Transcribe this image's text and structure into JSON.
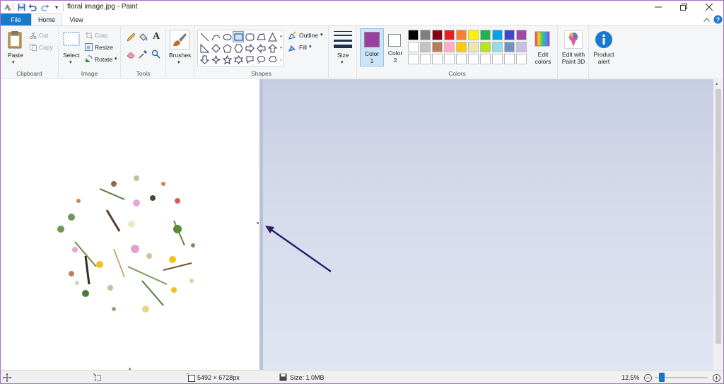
{
  "titlebar": {
    "title": "floral image.jpg - Paint",
    "quick_access": [
      "paint-app-icon",
      "save-icon",
      "undo-icon",
      "redo-icon",
      "customize-qa-icon"
    ],
    "window_controls": [
      "minimize-icon",
      "restore-icon",
      "close-icon"
    ]
  },
  "tabs": {
    "file": "File",
    "home": "Home",
    "view": "View"
  },
  "clipboard": {
    "paste": "Paste",
    "cut": "Cut",
    "copy": "Copy",
    "label": "Clipboard"
  },
  "image": {
    "select": "Select",
    "crop": "Crop",
    "resize": "Resize",
    "rotate": "Rotate",
    "label": "Image"
  },
  "tools": {
    "label": "Tools"
  },
  "brushes": {
    "label": "Brushes"
  },
  "shapes": {
    "outline": "Outline",
    "fill": "Fill",
    "label": "Shapes"
  },
  "size": {
    "label": "Size"
  },
  "colors": {
    "color1_line1": "Color",
    "color1_line2": "1",
    "color2_line1": "Color",
    "color2_line2": "2",
    "edit_line1": "Edit",
    "edit_line2": "colors",
    "label": "Colors",
    "color1_value": "#9a3fa0",
    "color2_value": "#ffffff",
    "palette_row1": [
      "#000000",
      "#7f7f7f",
      "#880015",
      "#ed1c24",
      "#ff7f27",
      "#fff200",
      "#22b14c",
      "#00a2e8",
      "#3f48cc",
      "#a349a4"
    ],
    "palette_row2": [
      "#ffffff",
      "#c3c3c3",
      "#b97a57",
      "#ffaec9",
      "#ffc90e",
      "#efe4b0",
      "#b5e61d",
      "#99d9ea",
      "#7092be",
      "#c8bfe7"
    ],
    "palette_row3": [
      "#ffffff",
      "#ffffff",
      "#ffffff",
      "#ffffff",
      "#ffffff",
      "#ffffff",
      "#ffffff",
      "#ffffff",
      "#ffffff",
      "#ffffff"
    ]
  },
  "paint3d": {
    "line1": "Edit with",
    "line2": "Paint 3D"
  },
  "product_alert": {
    "line1": "Product",
    "line2": "alert"
  },
  "status": {
    "dimensions": "5492 × 6728px",
    "size": "Size: 1.0MB",
    "zoom": "12.5%"
  },
  "accent": {
    "file_tab": "#1979ca",
    "arrow": "#2e1a6b"
  }
}
